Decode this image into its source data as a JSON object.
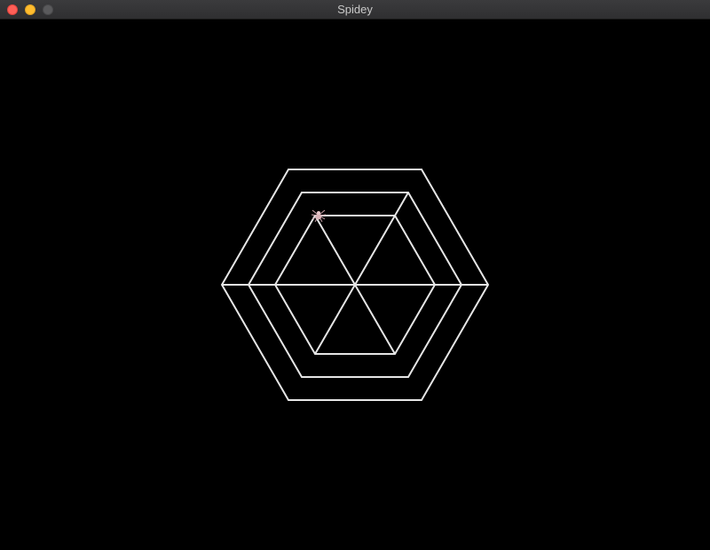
{
  "window": {
    "title": "Spidey"
  },
  "colors": {
    "background": "#000000",
    "web_stroke": "#e6e6e6",
    "spider": "#d9b3b8"
  },
  "game": {
    "web_rings": 3,
    "web_spokes": 6,
    "player_icon": "spider-icon"
  }
}
